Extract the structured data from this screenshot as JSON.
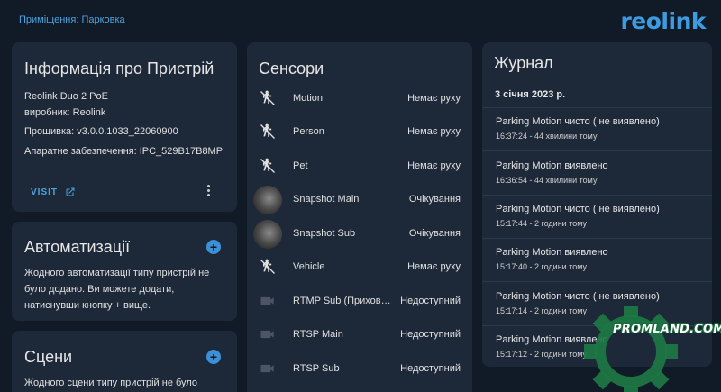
{
  "breadcrumb": "Приміщення: Парковка",
  "logo": "reolink",
  "device_card": {
    "title": "Інформація про Пристрій",
    "model": "Reolink Duo 2 PoE",
    "manufacturer": "виробник: Reolink",
    "firmware": "Прошивка: v3.0.0.1033_22060900",
    "hardware": "Апаратне забезпечення: IPC_529B17B8MP",
    "visit_label": "VISIT"
  },
  "automations_card": {
    "title": "Автоматизації",
    "add_icon": "plus",
    "description": "Жодного автоматизації типу пристрій не було додано. Ви можете додати, натиснувши кнопку + вище."
  },
  "scenes_card": {
    "title": "Сцени",
    "add_icon": "plus",
    "description": "Жодного сцени типу пристрій не було"
  },
  "sensors_card": {
    "title": "Сенсори",
    "items": [
      {
        "name": "Motion",
        "state": "Немає руху",
        "icon": "motion-sensor-icon"
      },
      {
        "name": "Person",
        "state": "Немає руху",
        "icon": "motion-sensor-icon"
      },
      {
        "name": "Pet",
        "state": "Немає руху",
        "icon": "motion-sensor-icon"
      },
      {
        "name": "Snapshot Main",
        "state": "Очікування",
        "icon": "snapshot-thumbnail"
      },
      {
        "name": "Snapshot Sub",
        "state": "Очікування",
        "icon": "snapshot-thumbnail"
      },
      {
        "name": "Vehicle",
        "state": "Немає руху",
        "icon": "motion-sensor-icon"
      },
      {
        "name": "RTMP Sub (Прихов…",
        "state": "Недоступний",
        "icon": "video-camera-icon"
      },
      {
        "name": "RTSP Main",
        "state": "Недоступний",
        "icon": "video-camera-icon"
      },
      {
        "name": "RTSP Sub",
        "state": "Недоступний",
        "icon": "video-camera-icon"
      }
    ]
  },
  "log_card": {
    "title": "Журнал",
    "date": "3 січня 2023 р.",
    "entries": [
      {
        "name": "Parking Motion",
        "state": "чисто ( не виявлено)",
        "time": "16:37:24 - 44 хвилини тому"
      },
      {
        "name": "Parking Motion",
        "state": "виявлено",
        "time": "16:36:54 - 44 хвилини тому"
      },
      {
        "name": "Parking Motion",
        "state": "чисто ( не виявлено)",
        "time": "15:17:44 - 2 години тому"
      },
      {
        "name": "Parking Motion",
        "state": "виявлено",
        "time": "15:17:40 - 2 години тому"
      },
      {
        "name": "Parking Motion",
        "state": "чисто ( не виявлено)",
        "time": "15:17:14 - 2 години тому"
      },
      {
        "name": "Parking Motion",
        "state": "виявлено",
        "time": "15:17:12 - 2 години тому"
      }
    ]
  },
  "watermark": "PROMLAND.COM.UA",
  "colors": {
    "background": "#111b27",
    "card": "#1d2838",
    "accent": "#3d9be0",
    "watermark_green": "#16693a"
  }
}
